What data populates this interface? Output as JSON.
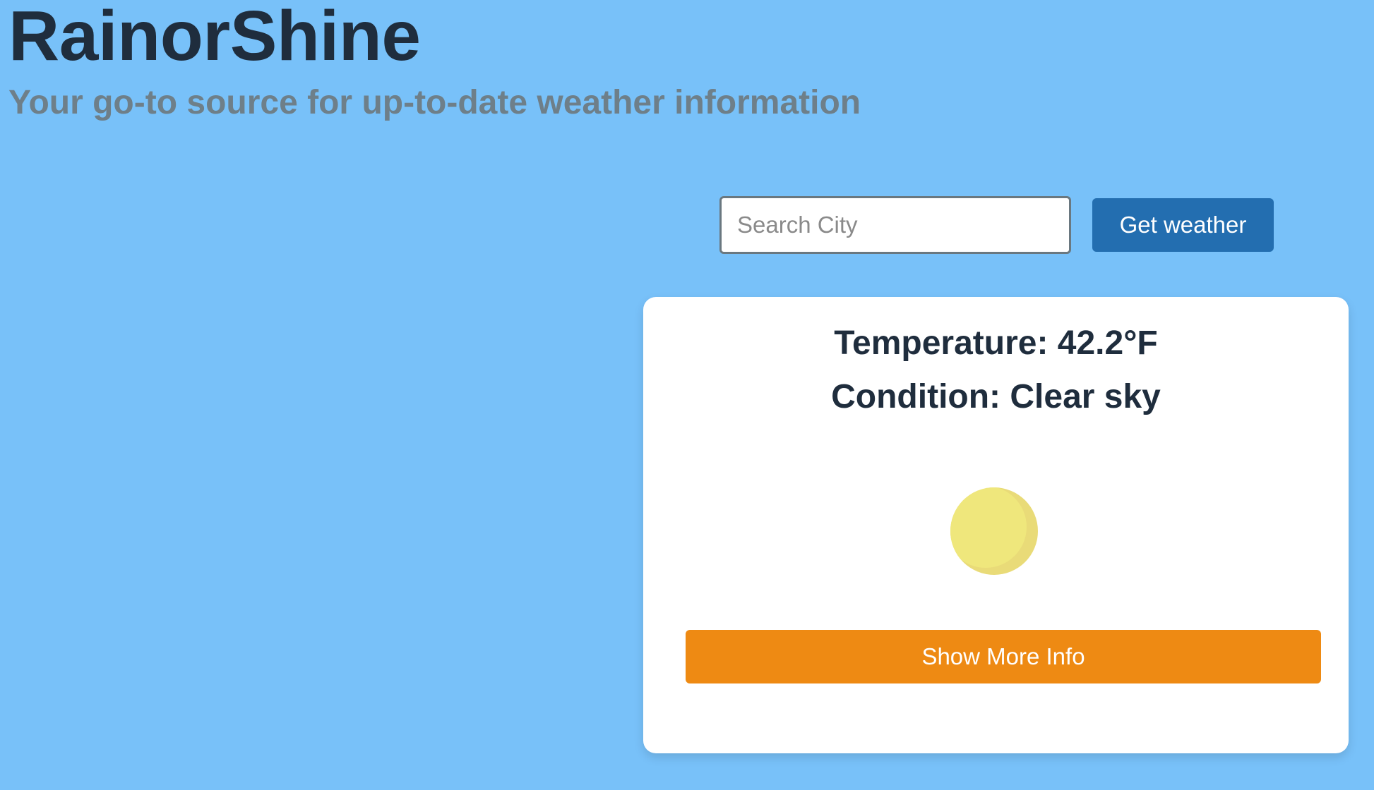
{
  "header": {
    "title": "RainorShine",
    "tagline": "Your go-to source for up-to-date weather information"
  },
  "search": {
    "placeholder": "Search City",
    "value": "",
    "button_label": "Get weather"
  },
  "weather": {
    "temperature_text": "Temperature: 42.2°F",
    "condition_text": "Condition: Clear sky",
    "icon": "sun-icon",
    "more_info_label": "Show More Info"
  },
  "colors": {
    "background": "#78c1f9",
    "title": "#1f2d3d",
    "tagline": "#6e7f89",
    "primary_button": "#236eb0",
    "secondary_button": "#ee8a13",
    "sun": "#efe77c"
  }
}
